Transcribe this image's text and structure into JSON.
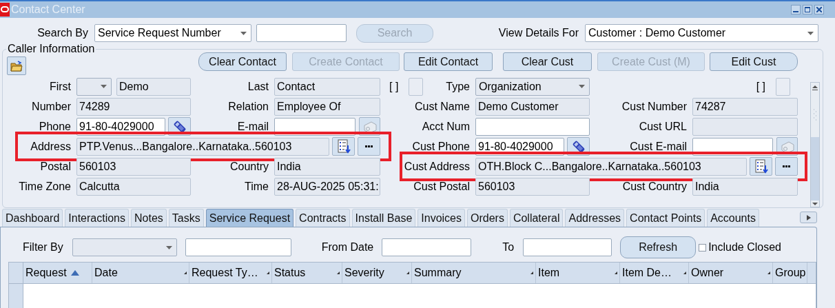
{
  "window": {
    "title": "Contact Center"
  },
  "search": {
    "label": "Search By",
    "by": "Service Request Number",
    "button": {
      "label": "Search",
      "disabled": true
    },
    "view_label": "View Details For",
    "view_value": "Customer : Demo Customer"
  },
  "caller": {
    "title": "Caller Information",
    "buttons": [
      {
        "label": "Clear Contact",
        "disabled": false
      },
      {
        "label": "Create Contact",
        "disabled": true
      },
      {
        "label": "Edit Contact",
        "disabled": false
      },
      {
        "label": "Clear Cust",
        "disabled": false
      },
      {
        "label": "Create Cust (M)",
        "disabled": true
      },
      {
        "label": "Edit Cust",
        "disabled": false
      }
    ],
    "contact_rows": [
      {
        "cells": [
          {
            "kind": "name",
            "label": "First",
            "value": "Demo",
            "editable": false
          },
          {
            "kind": "text",
            "label": "Last",
            "value": "Contact",
            "editable": false
          }
        ]
      },
      {
        "cells": [
          {
            "kind": "text",
            "label": "Number",
            "value": "74289",
            "editable": false
          },
          {
            "kind": "text",
            "label": "Relation",
            "value": "Employee Of",
            "editable": false
          }
        ]
      },
      {
        "cells": [
          {
            "kind": "phone",
            "label": "Phone",
            "value": "91-80-4029000",
            "editable": true
          },
          {
            "kind": "email",
            "label": "E-mail",
            "editable": true
          }
        ]
      },
      {
        "cells": [
          {
            "kind": "address",
            "label": "Address",
            "value": "PTP.Venus...Bangalore..Karnataka..560103",
            "editable": false,
            "highlighted": true
          }
        ]
      },
      {
        "cells": [
          {
            "kind": "text",
            "label": "Postal",
            "value": "560103",
            "editable": false
          },
          {
            "kind": "text",
            "label": "Country",
            "value": "India",
            "editable": false
          }
        ]
      },
      {
        "cells": [
          {
            "kind": "text",
            "label": "Time Zone",
            "value": "Calcutta",
            "editable": false
          },
          {
            "kind": "text",
            "label": "Time",
            "value": "28-AUG-2025 05:31:",
            "editable": false
          }
        ]
      }
    ],
    "customer_rows": [
      {
        "cells": [
          {
            "kind": "select",
            "flag": "[ ]",
            "label": "Type",
            "value": "Organization",
            "editable": false
          },
          {
            "kind": "flag",
            "flag": "[ ]"
          }
        ]
      },
      {
        "cells": [
          {
            "kind": "text",
            "label": "Cust Name",
            "value": "Demo Customer",
            "editable": false
          },
          {
            "kind": "text",
            "label": "Cust Number",
            "value": "74287",
            "editable": false
          }
        ]
      },
      {
        "cells": [
          {
            "kind": "text",
            "label": "Acct Num",
            "editable": true
          },
          {
            "kind": "text",
            "label": "Cust URL",
            "editable": false
          }
        ]
      },
      {
        "cells": [
          {
            "kind": "phone",
            "label": "Cust Phone",
            "value": "91-80-4029000",
            "editable": true
          },
          {
            "kind": "email",
            "label": "Cust E-mail",
            "editable": true
          }
        ]
      },
      {
        "cells": [
          {
            "kind": "address",
            "label": "Cust Address",
            "value": "OTH.Block C...Bangalore..Karnataka..560103",
            "editable": false,
            "highlighted": true
          }
        ]
      },
      {
        "cells": [
          {
            "kind": "text",
            "label": "Cust Postal",
            "value": "560103",
            "editable": false
          },
          {
            "kind": "text",
            "label": "Cust Country",
            "value": "India",
            "editable": false
          }
        ]
      }
    ]
  },
  "tabs": [
    {
      "label": "Dashboard",
      "selected": false
    },
    {
      "label": "Interactions",
      "selected": false
    },
    {
      "label": "Notes",
      "selected": false
    },
    {
      "label": "Tasks",
      "selected": false
    },
    {
      "label": "Service Request",
      "selected": true
    },
    {
      "label": "Contracts",
      "selected": false
    },
    {
      "label": "Install Base",
      "selected": false
    },
    {
      "label": "Invoices",
      "selected": false
    },
    {
      "label": "Orders",
      "selected": false
    },
    {
      "label": "Collateral",
      "selected": false
    },
    {
      "label": "Addresses",
      "selected": false
    },
    {
      "label": "Contact Points",
      "selected": false
    },
    {
      "label": "Accounts",
      "selected": false
    }
  ],
  "filter": {
    "label": "Filter By",
    "from_label": "From Date",
    "to_label": "To",
    "button": "Refresh",
    "include_closed": {
      "label": "Include Closed",
      "checked": false
    }
  },
  "table": {
    "columns": [
      {
        "label": "Request",
        "sorted": true
      },
      {
        "label": "Date",
        "sorted": false
      },
      {
        "label": "Request Ty…",
        "sorted": false
      },
      {
        "label": "Status",
        "sorted": false
      },
      {
        "label": "Severity",
        "sorted": false
      },
      {
        "label": "Summary",
        "sorted": false
      },
      {
        "label": "Item",
        "sorted": false
      },
      {
        "label": "Item De…",
        "sorted": false
      },
      {
        "label": "Owner",
        "sorted": false
      },
      {
        "label": "Group"
      }
    ]
  }
}
